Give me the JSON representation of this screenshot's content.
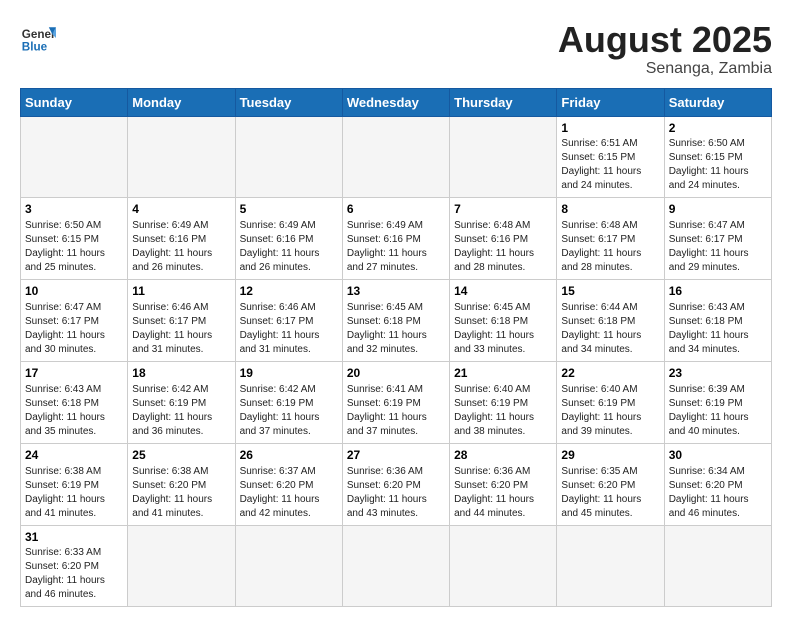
{
  "header": {
    "logo_general": "General",
    "logo_blue": "Blue",
    "month_year": "August 2025",
    "location": "Senanga, Zambia"
  },
  "weekdays": [
    "Sunday",
    "Monday",
    "Tuesday",
    "Wednesday",
    "Thursday",
    "Friday",
    "Saturday"
  ],
  "weeks": [
    [
      {
        "day": "",
        "info": ""
      },
      {
        "day": "",
        "info": ""
      },
      {
        "day": "",
        "info": ""
      },
      {
        "day": "",
        "info": ""
      },
      {
        "day": "",
        "info": ""
      },
      {
        "day": "1",
        "info": "Sunrise: 6:51 AM\nSunset: 6:15 PM\nDaylight: 11 hours\nand 24 minutes."
      },
      {
        "day": "2",
        "info": "Sunrise: 6:50 AM\nSunset: 6:15 PM\nDaylight: 11 hours\nand 24 minutes."
      }
    ],
    [
      {
        "day": "3",
        "info": "Sunrise: 6:50 AM\nSunset: 6:15 PM\nDaylight: 11 hours\nand 25 minutes."
      },
      {
        "day": "4",
        "info": "Sunrise: 6:49 AM\nSunset: 6:16 PM\nDaylight: 11 hours\nand 26 minutes."
      },
      {
        "day": "5",
        "info": "Sunrise: 6:49 AM\nSunset: 6:16 PM\nDaylight: 11 hours\nand 26 minutes."
      },
      {
        "day": "6",
        "info": "Sunrise: 6:49 AM\nSunset: 6:16 PM\nDaylight: 11 hours\nand 27 minutes."
      },
      {
        "day": "7",
        "info": "Sunrise: 6:48 AM\nSunset: 6:16 PM\nDaylight: 11 hours\nand 28 minutes."
      },
      {
        "day": "8",
        "info": "Sunrise: 6:48 AM\nSunset: 6:17 PM\nDaylight: 11 hours\nand 28 minutes."
      },
      {
        "day": "9",
        "info": "Sunrise: 6:47 AM\nSunset: 6:17 PM\nDaylight: 11 hours\nand 29 minutes."
      }
    ],
    [
      {
        "day": "10",
        "info": "Sunrise: 6:47 AM\nSunset: 6:17 PM\nDaylight: 11 hours\nand 30 minutes."
      },
      {
        "day": "11",
        "info": "Sunrise: 6:46 AM\nSunset: 6:17 PM\nDaylight: 11 hours\nand 31 minutes."
      },
      {
        "day": "12",
        "info": "Sunrise: 6:46 AM\nSunset: 6:17 PM\nDaylight: 11 hours\nand 31 minutes."
      },
      {
        "day": "13",
        "info": "Sunrise: 6:45 AM\nSunset: 6:18 PM\nDaylight: 11 hours\nand 32 minutes."
      },
      {
        "day": "14",
        "info": "Sunrise: 6:45 AM\nSunset: 6:18 PM\nDaylight: 11 hours\nand 33 minutes."
      },
      {
        "day": "15",
        "info": "Sunrise: 6:44 AM\nSunset: 6:18 PM\nDaylight: 11 hours\nand 34 minutes."
      },
      {
        "day": "16",
        "info": "Sunrise: 6:43 AM\nSunset: 6:18 PM\nDaylight: 11 hours\nand 34 minutes."
      }
    ],
    [
      {
        "day": "17",
        "info": "Sunrise: 6:43 AM\nSunset: 6:18 PM\nDaylight: 11 hours\nand 35 minutes."
      },
      {
        "day": "18",
        "info": "Sunrise: 6:42 AM\nSunset: 6:19 PM\nDaylight: 11 hours\nand 36 minutes."
      },
      {
        "day": "19",
        "info": "Sunrise: 6:42 AM\nSunset: 6:19 PM\nDaylight: 11 hours\nand 37 minutes."
      },
      {
        "day": "20",
        "info": "Sunrise: 6:41 AM\nSunset: 6:19 PM\nDaylight: 11 hours\nand 37 minutes."
      },
      {
        "day": "21",
        "info": "Sunrise: 6:40 AM\nSunset: 6:19 PM\nDaylight: 11 hours\nand 38 minutes."
      },
      {
        "day": "22",
        "info": "Sunrise: 6:40 AM\nSunset: 6:19 PM\nDaylight: 11 hours\nand 39 minutes."
      },
      {
        "day": "23",
        "info": "Sunrise: 6:39 AM\nSunset: 6:19 PM\nDaylight: 11 hours\nand 40 minutes."
      }
    ],
    [
      {
        "day": "24",
        "info": "Sunrise: 6:38 AM\nSunset: 6:19 PM\nDaylight: 11 hours\nand 41 minutes."
      },
      {
        "day": "25",
        "info": "Sunrise: 6:38 AM\nSunset: 6:20 PM\nDaylight: 11 hours\nand 41 minutes."
      },
      {
        "day": "26",
        "info": "Sunrise: 6:37 AM\nSunset: 6:20 PM\nDaylight: 11 hours\nand 42 minutes."
      },
      {
        "day": "27",
        "info": "Sunrise: 6:36 AM\nSunset: 6:20 PM\nDaylight: 11 hours\nand 43 minutes."
      },
      {
        "day": "28",
        "info": "Sunrise: 6:36 AM\nSunset: 6:20 PM\nDaylight: 11 hours\nand 44 minutes."
      },
      {
        "day": "29",
        "info": "Sunrise: 6:35 AM\nSunset: 6:20 PM\nDaylight: 11 hours\nand 45 minutes."
      },
      {
        "day": "30",
        "info": "Sunrise: 6:34 AM\nSunset: 6:20 PM\nDaylight: 11 hours\nand 46 minutes."
      }
    ],
    [
      {
        "day": "31",
        "info": "Sunrise: 6:33 AM\nSunset: 6:20 PM\nDaylight: 11 hours\nand 46 minutes."
      },
      {
        "day": "",
        "info": ""
      },
      {
        "day": "",
        "info": ""
      },
      {
        "day": "",
        "info": ""
      },
      {
        "day": "",
        "info": ""
      },
      {
        "day": "",
        "info": ""
      },
      {
        "day": "",
        "info": ""
      }
    ]
  ]
}
